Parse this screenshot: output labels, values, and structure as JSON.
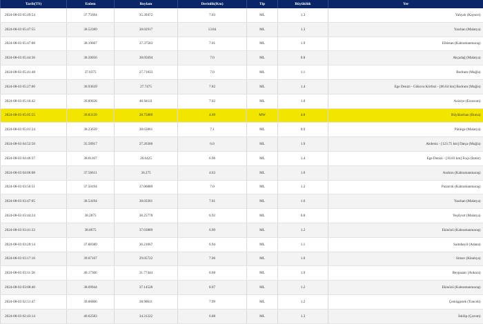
{
  "columns": {
    "date": "Tarih(TS)",
    "lat": "Enlem",
    "lon": "Boylam",
    "depth": "Derinlik(Km)",
    "type": "Tip",
    "mag": "Büyüklük",
    "loc": "Yer"
  },
  "highlight_color": "#f2e600",
  "header_color": "#0a2668",
  "rows": [
    {
      "date": "2024-08-03 05:49:54",
      "lat": "37.75694",
      "lon": "35.39472",
      "depth": "7.03",
      "type": "ML",
      "mag": "1.3",
      "loc": "Yahyalı (Kayseri)"
    },
    {
      "date": "2024-08-03 05:47:55",
      "lat": "38.52389",
      "lon": "38.02917",
      "depth": "13.84",
      "type": "ML",
      "mag": "1.3",
      "loc": "Yazıhan (Malatya)"
    },
    {
      "date": "2024-08-03 05:47:08",
      "lat": "38.19667",
      "lon": "37.37583",
      "depth": "7.01",
      "type": "ML",
      "mag": "1.9",
      "loc": "Elbistan (Kahramanmaraş)"
    },
    {
      "date": "2024-08-03 05:44:36",
      "lat": "38.50056",
      "lon": "38.05694",
      "depth": "7.0",
      "type": "ML",
      "mag": "0.8",
      "loc": "Akçadağ (Malatya)"
    },
    {
      "date": "2024-08-03 05:41:48",
      "lat": "37.0375",
      "lon": "27.71833",
      "depth": "7.0",
      "type": "ML",
      "mag": "1.1",
      "loc": "Bodrum (Muğla)"
    },
    {
      "date": "2024-08-03 05:27:00",
      "lat": "36.93639",
      "lon": "27.7475",
      "depth": "7.82",
      "type": "ML",
      "mag": "1.4",
      "loc": "Ege Denizi - Gökova Körfezi - [06.64 km] Bodrum (Muğla)"
    },
    {
      "date": "2024-08-03 05:16:42",
      "lat": "39.89028",
      "lon": "40.94111",
      "depth": "7.02",
      "type": "ML",
      "mag": "1.0",
      "loc": "Aziziye (Erzurum)"
    },
    {
      "date": "2024-08-03 05:05:55",
      "lat": "39.83139",
      "lon": "28.75889",
      "depth": "4.69",
      "type": "MW",
      "mag": "4.0",
      "loc": "Büyükorhan (Bursa)",
      "highlight": true
    },
    {
      "date": "2024-08-03 05:01:24",
      "lat": "38.23639",
      "lon": "38.63861",
      "depth": "7.1",
      "type": "ML",
      "mag": "0.9",
      "loc": "Pütürge (Malatya)"
    },
    {
      "date": "2024-08-03 04:52:50",
      "lat": "35.58917",
      "lon": "27.26306",
      "depth": "6.0",
      "type": "ML",
      "mag": "1.9",
      "loc": "Akdeniz - [123.75 km] Datça (Muğla)"
    },
    {
      "date": "2024-08-03 04:46:37",
      "lat": "38.81167",
      "lon": "26.6425",
      "depth": "6.96",
      "type": "ML",
      "mag": "1.4",
      "loc": "Ege Denizi - [16.83 km] Foça (İzmir)"
    },
    {
      "date": "2024-08-03 04:06:08",
      "lat": "37.56611",
      "lon": "36.275",
      "depth": "4.63",
      "type": "ML",
      "mag": "1.0",
      "loc": "Andırın (Kahramanmaraş)"
    },
    {
      "date": "2024-08-03 03:56:51",
      "lat": "37.50194",
      "lon": "37.06889",
      "depth": "7.0",
      "type": "ML",
      "mag": "1.2",
      "loc": "Pazarcık (Kahramanmaraş)"
    },
    {
      "date": "2024-08-03 03:47:05",
      "lat": "38.54194",
      "lon": "38.03361",
      "depth": "7.01",
      "type": "ML",
      "mag": "1.6",
      "loc": "Yazıhan (Malatya)"
    },
    {
      "date": "2024-08-03 03:44:24",
      "lat": "38.2875",
      "lon": "38.25778",
      "depth": "6.92",
      "type": "ML",
      "mag": "0.8",
      "loc": "Yeşilyurt (Malatya)"
    },
    {
      "date": "2024-08-03 03:41:33",
      "lat": "38.0675",
      "lon": "37.03889",
      "depth": "6.99",
      "type": "ML",
      "mag": "1.2",
      "loc": "Ekinözü (Kahramanmaraş)"
    },
    {
      "date": "2024-08-03 03:20:14",
      "lat": "37.88389",
      "lon": "36.21667",
      "depth": "6.94",
      "type": "ML",
      "mag": "1.1",
      "loc": "Saimbeyli (Adana)"
    },
    {
      "date": "2024-08-03 03:17:10",
      "lat": "39.07167",
      "lon": "29.05722",
      "depth": "7.06",
      "type": "ML",
      "mag": "1.0",
      "loc": "Simav (Kütahya)"
    },
    {
      "date": "2024-08-03 03:11:58",
      "lat": "40.17306",
      "lon": "31.77444",
      "depth": "6.68",
      "type": "ML",
      "mag": "1.9",
      "loc": "Beypazarı (Ankara)"
    },
    {
      "date": "2024-08-03 03:08:40",
      "lat": "38.09944",
      "lon": "37.14528",
      "depth": "8.07",
      "type": "ML",
      "mag": "1.2",
      "loc": "Ekinözü (Kahramanmaraş)"
    },
    {
      "date": "2024-08-03 02:51:47",
      "lat": "39.06806",
      "lon": "38.98611",
      "depth": "7.99",
      "type": "ML",
      "mag": "1.2",
      "loc": "Çemişgezek (Tunceli)"
    },
    {
      "date": "2024-08-03 02:43:14",
      "lat": "40.62583",
      "lon": "34.31222",
      "depth": "6.88",
      "type": "ML",
      "mag": "1.3",
      "loc": "İskilip (Çorum)"
    }
  ]
}
